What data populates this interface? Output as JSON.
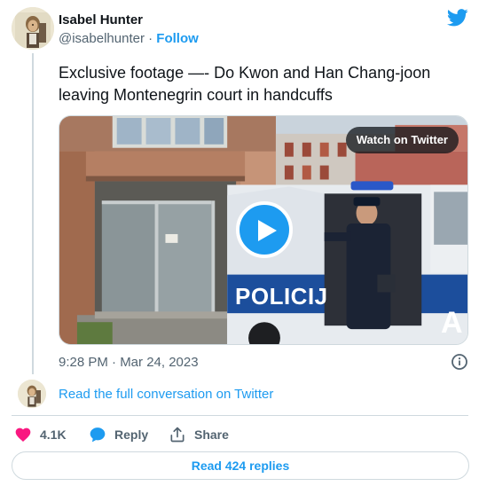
{
  "author": {
    "name": "Isabel Hunter",
    "handle": "@isabelhunter",
    "separator": " · ",
    "follow_label": "Follow"
  },
  "tweet": {
    "text": "Exclusive footage —- Do Kwon and Han Chang-joon leaving Montenegrin court in handcuffs",
    "timestamp": "9:28 PM · Mar 24, 2023"
  },
  "media": {
    "watch_label": "Watch on Twitter",
    "van_text": "POLICIJ",
    "van_text_right": "A"
  },
  "conversation_link": "Read the full conversation on Twitter",
  "actions": {
    "like_count": "4.1K",
    "reply_label": "Reply",
    "share_label": "Share"
  },
  "replies_button": "Read 424 replies",
  "colors": {
    "accent": "#1d9bf0",
    "like": "#f91880",
    "text_primary": "#0f1419",
    "text_secondary": "#536471",
    "border": "#cfd9de"
  },
  "icons": [
    "twitter-bird-icon",
    "play-icon",
    "info-icon",
    "heart-icon",
    "reply-bubble-icon",
    "share-icon"
  ]
}
